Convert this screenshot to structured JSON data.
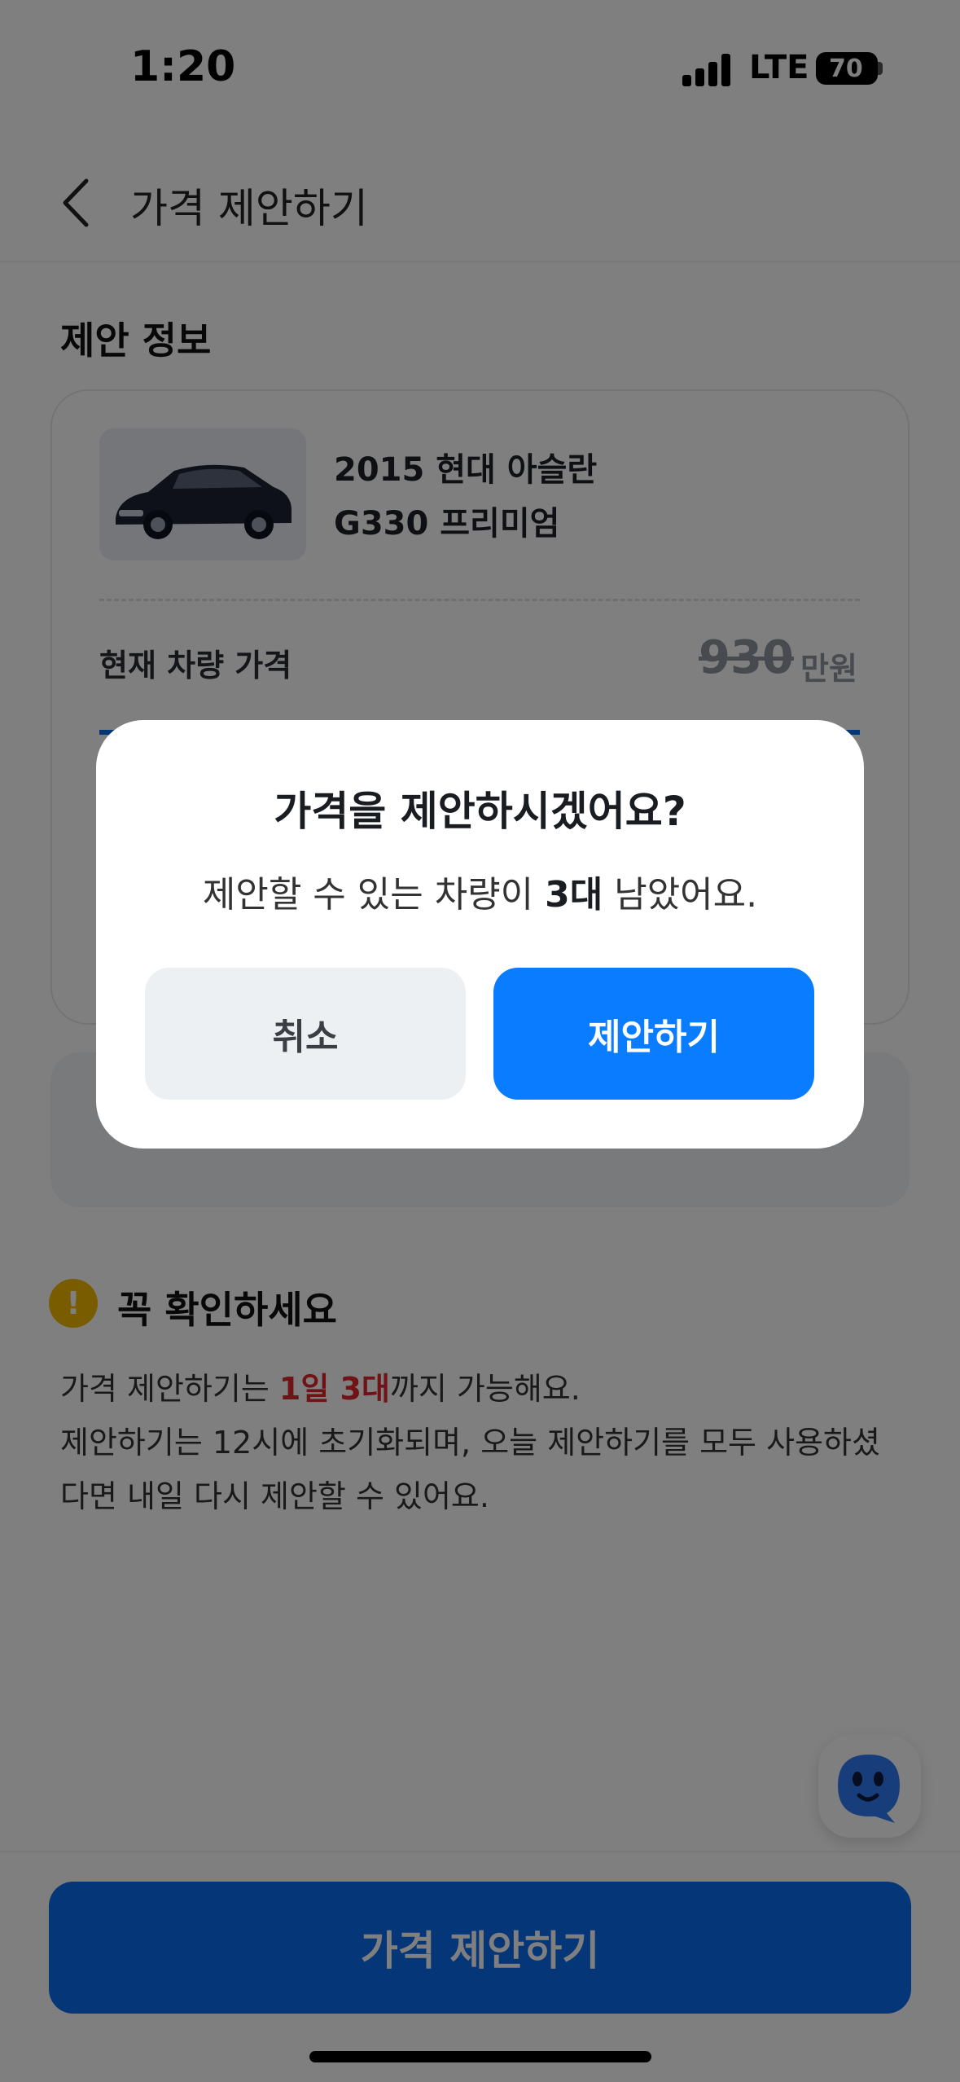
{
  "status_bar": {
    "time": "1:20",
    "network": "LTE",
    "battery": "70"
  },
  "header": {
    "title": "가격 제안하기"
  },
  "proposal": {
    "section_title": "제안 정보",
    "car_name_line1": "2015 현대 아슬란",
    "car_name_line2": "G330 프리미엄",
    "price_label": "현재 차량 가격",
    "price_value": "930",
    "price_unit": "만원"
  },
  "notice": {
    "title": "꼭 확인하세요",
    "line1_pre": "가격 제안하기는 ",
    "line1_highlight": "1일 3대",
    "line1_post": "까지 가능해요.",
    "line2": "제안하기는 12시에 초기화되며, 오늘 제안하기를 모두 사용하셨",
    "line3": "다면 내일 다시 제안할 수 있어요."
  },
  "cta": {
    "label": "가격 제안하기"
  },
  "modal": {
    "title": "가격을 제안하시겠어요?",
    "message_pre": "제안할 수 있는 차량이 ",
    "message_bold": "3대",
    "message_post": " 남았어요.",
    "cancel_label": "취소",
    "confirm_label": "제안하기"
  },
  "colors": {
    "primary": "#0a7cff",
    "highlight": "#e0262f",
    "warning": "#f5b800"
  }
}
